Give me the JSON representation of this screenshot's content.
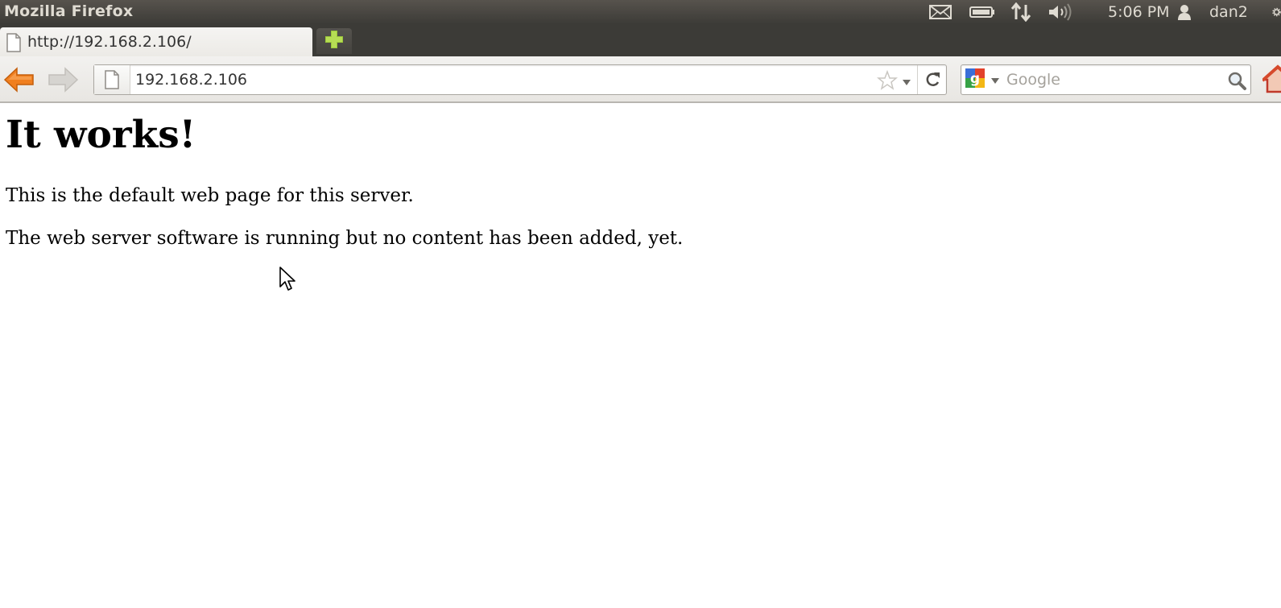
{
  "window": {
    "title": "Mozilla Firefox"
  },
  "system_tray": {
    "icons": [
      "mail-icon",
      "battery-icon",
      "network-icon",
      "volume-icon",
      "user-icon",
      "gear-icon"
    ],
    "clock": "5:06 PM",
    "username": "dan2"
  },
  "tabs": [
    {
      "label": "http://192.168.2.106/",
      "active": true
    }
  ],
  "toolbar": {
    "url": "192.168.2.106",
    "search_placeholder": "Google",
    "search_engine": "google-icon"
  },
  "page": {
    "heading": "It works!",
    "paragraphs": [
      "This is the default web page for this server.",
      "The web server software is running but no content has been added, yet."
    ]
  },
  "colors": {
    "titlebar": "#3c3b37",
    "back_arrow": "#f07f1f",
    "newtab_plus": "#9cc83a"
  }
}
